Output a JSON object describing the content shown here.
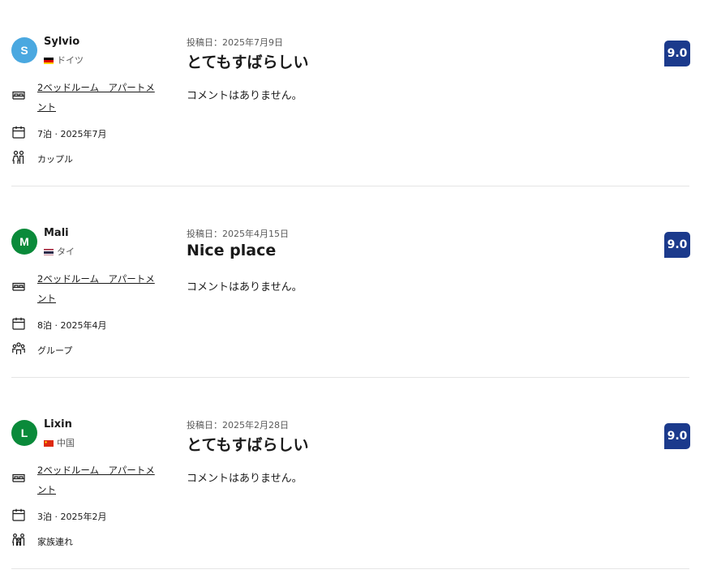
{
  "reviews": [
    {
      "avatar_initial": "S",
      "avatar_color": "#4aa8e0",
      "name": "Sylvio",
      "country": "ドイツ",
      "flag": "germany",
      "room": "2ベッドルーム　アパートメント",
      "stay": "7泊 · 2025年7月",
      "traveler_type": "カップル",
      "traveler_icon": "couple-icon",
      "date": "投稿日：2025年7月9日",
      "title": "とてもすばらしい",
      "comment": "コメントはありません。",
      "score": "9.0"
    },
    {
      "avatar_initial": "M",
      "avatar_color": "#0a8a3a",
      "name": "Mali",
      "country": "タイ",
      "flag": "thailand",
      "room": "2ベッドルーム　アパートメント",
      "stay": "8泊 · 2025年4月",
      "traveler_type": "グループ",
      "traveler_icon": "group-icon",
      "date": "投稿日：2025年4月15日",
      "title": "Nice place",
      "comment": "コメントはありません。",
      "score": "9.0"
    },
    {
      "avatar_initial": "L",
      "avatar_color": "#0a8a3a",
      "name": "Lixin",
      "country": "中国",
      "flag": "china",
      "room": "2ベッドルーム　アパートメント",
      "stay": "3泊 · 2025年2月",
      "traveler_type": "家族連れ",
      "traveler_icon": "family-icon",
      "date": "投稿日：2025年2月28日",
      "title": "とてもすばらしい",
      "comment": "コメントはありません。",
      "score": "9.0"
    }
  ],
  "colors": {
    "score_bg": "#1b3a8c",
    "divider": "#e5e5e5",
    "secondary_text": "#595959"
  },
  "icons": {
    "room": "bed-icon",
    "stay": "calendar-icon"
  }
}
